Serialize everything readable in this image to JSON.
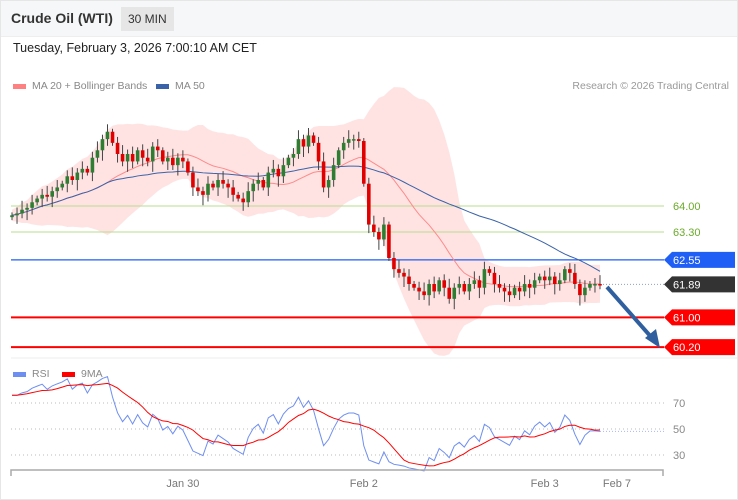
{
  "header": {
    "title": "Crude Oil (WTI)",
    "interval": "30 MIN",
    "datetime": "Tuesday, February 3, 2026 7:00:10 AM CET"
  },
  "legend": {
    "ma20": "MA 20 + Bollinger Bands",
    "ma50": "MA 50",
    "rsi": "RSI",
    "ma9": "9MA",
    "credit": "Research © 2026 Trading Central"
  },
  "colors": {
    "up": "#2e7d32",
    "down": "#e00000",
    "band": "#ffdede",
    "ma20": "#ff8a8a",
    "ma50": "#3a62a8",
    "rsi": "#6f8ff0",
    "ma9": "#ff0000",
    "resistance": "#1f5ff5",
    "support": "#ff0000",
    "last": "#333333",
    "pivot": "#8cc63f",
    "arrow": "#2f5f9e"
  },
  "levels": [
    {
      "value": 64.0,
      "label": "64.00",
      "type": "pivot"
    },
    {
      "value": 63.3,
      "label": "63.30",
      "type": "pivot"
    },
    {
      "value": 62.55,
      "label": "62.55",
      "type": "resistance"
    },
    {
      "value": 61.89,
      "label": "61.89",
      "type": "last"
    },
    {
      "value": 61.0,
      "label": "61.00",
      "type": "support"
    },
    {
      "value": 60.2,
      "label": "60.20",
      "type": "support"
    }
  ],
  "rsi_levels": [
    {
      "value": 70,
      "label": "70"
    },
    {
      "value": 50,
      "label": "50"
    },
    {
      "value": 30,
      "label": "30"
    }
  ],
  "xaxis": [
    {
      "label": "Jan 30",
      "index": 34
    },
    {
      "label": "Feb 2",
      "index": 70
    },
    {
      "label": "Feb 3",
      "index": 106
    },
    {
      "label": "Feb 7",
      "index": 119
    }
  ],
  "closes": [
    63.75,
    63.8,
    63.9,
    63.95,
    64.1,
    64.2,
    64.3,
    64.25,
    64.4,
    64.5,
    64.6,
    64.8,
    64.7,
    64.9,
    65.0,
    64.9,
    65.3,
    65.5,
    65.8,
    66.0,
    65.7,
    65.4,
    65.2,
    65.4,
    65.2,
    65.5,
    65.3,
    65.2,
    65.6,
    65.5,
    65.2,
    65.3,
    65.1,
    65.3,
    65.2,
    64.9,
    64.5,
    64.4,
    64.3,
    64.6,
    64.5,
    64.7,
    64.6,
    64.5,
    64.3,
    64.2,
    64.1,
    64.4,
    64.6,
    64.7,
    64.5,
    64.9,
    65.0,
    64.8,
    65.1,
    65.3,
    65.4,
    65.8,
    65.6,
    65.9,
    65.7,
    65.2,
    64.5,
    64.7,
    65.1,
    65.5,
    65.7,
    65.8,
    65.8,
    65.75,
    64.6,
    63.5,
    63.3,
    63.1,
    63.5,
    62.6,
    62.3,
    62.2,
    62.1,
    61.9,
    61.8,
    61.7,
    61.6,
    61.9,
    61.7,
    62.0,
    61.8,
    61.5,
    61.8,
    61.9,
    61.7,
    61.9,
    62.0,
    61.8,
    62.3,
    62.2,
    61.9,
    61.8,
    61.7,
    61.6,
    61.8,
    61.7,
    61.9,
    61.8,
    62.0,
    62.1,
    62.0,
    62.1,
    61.9,
    62.0,
    62.3,
    62.2,
    61.9,
    61.6,
    61.8,
    61.9,
    61.9,
    61.89
  ]
}
